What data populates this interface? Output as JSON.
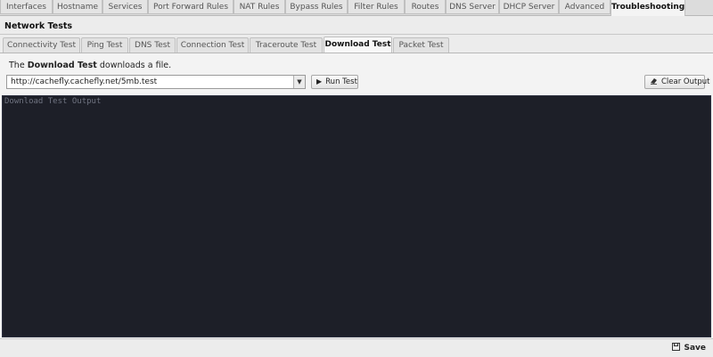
{
  "top_tabs": [
    {
      "label": "Interfaces"
    },
    {
      "label": "Hostname"
    },
    {
      "label": "Services"
    },
    {
      "label": "Port Forward Rules"
    },
    {
      "label": "NAT Rules"
    },
    {
      "label": "Bypass Rules"
    },
    {
      "label": "Filter Rules"
    },
    {
      "label": "Routes"
    },
    {
      "label": "DNS Server"
    },
    {
      "label": "DHCP Server"
    },
    {
      "label": "Advanced"
    },
    {
      "label": "Troubleshooting"
    }
  ],
  "page_title": "Network Tests",
  "sub_tabs": [
    {
      "label": "Connectivity Test"
    },
    {
      "label": "Ping Test"
    },
    {
      "label": "DNS Test"
    },
    {
      "label": "Connection Test"
    },
    {
      "label": "Traceroute Test"
    },
    {
      "label": "Download Test"
    },
    {
      "label": "Packet Test"
    }
  ],
  "description": {
    "prefix": "The ",
    "bold": "Download Test",
    "suffix": " downloads a file."
  },
  "url_select": {
    "value": "http://cachefly.cachefly.net/5mb.test"
  },
  "buttons": {
    "run": "Run Test",
    "clear": "Clear Output",
    "save": "Save"
  },
  "output": {
    "placeholder": "Download Test Output"
  },
  "icons": {
    "run": "play-icon",
    "clear": "eraser-icon",
    "save": "floppy-disk-icon",
    "select_arrow": "chevron-down-icon"
  },
  "colors": {
    "output_bg": "#1d1f28",
    "output_text": "#6f7380"
  }
}
